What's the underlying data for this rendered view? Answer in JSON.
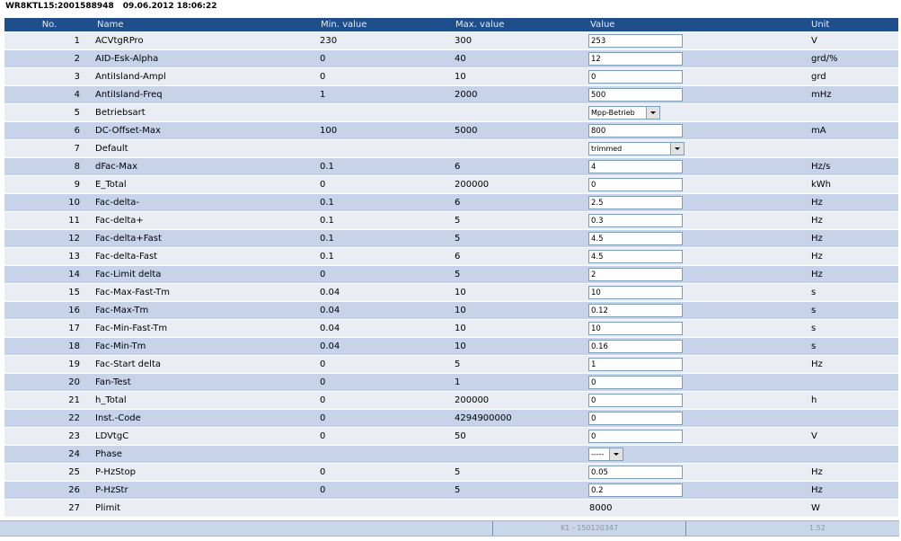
{
  "header": {
    "device": "WR8KTL15:2001588948",
    "timestamp": "09.06.2012 18:06:22"
  },
  "table": {
    "columns": {
      "no": "No.",
      "name": "Name",
      "min": "Min. value",
      "max": "Max. value",
      "value": "Value",
      "unit": "Unit"
    },
    "rows": [
      {
        "no": 1,
        "name": "ACVtgRPro",
        "min": "230",
        "max": "300",
        "value": "253",
        "unit": "V"
      },
      {
        "no": 2,
        "name": "AID-Esk-Alpha",
        "min": "0",
        "max": "40",
        "value": "12",
        "unit": "grd/%"
      },
      {
        "no": 3,
        "name": "AntiIsland-Ampl",
        "min": "0",
        "max": "10",
        "value": "0",
        "unit": "grd"
      },
      {
        "no": 4,
        "name": "AntiIsland-Freq",
        "min": "1",
        "max": "2000",
        "value": "500",
        "unit": "mHz"
      },
      {
        "no": 5,
        "name": "Betriebsart",
        "value": "Mpp-Betrieb"
      },
      {
        "no": 6,
        "name": "DC-Offset-Max",
        "min": "100",
        "max": "5000",
        "value": "800",
        "unit": "mA"
      },
      {
        "no": 7,
        "name": "Default",
        "value": "trimmed"
      },
      {
        "no": 8,
        "name": "dFac-Max",
        "min": "0.1",
        "max": "6",
        "value": "4",
        "unit": "Hz/s"
      },
      {
        "no": 9,
        "name": "E_Total",
        "min": "0",
        "max": "200000",
        "value": "0",
        "unit": "kWh"
      },
      {
        "no": 10,
        "name": "Fac-delta-",
        "min": "0.1",
        "max": "6",
        "value": "2.5",
        "unit": "Hz"
      },
      {
        "no": 11,
        "name": "Fac-delta+",
        "min": "0.1",
        "max": "5",
        "value": "0.3",
        "unit": "Hz"
      },
      {
        "no": 12,
        "name": "Fac-delta+Fast",
        "min": "0.1",
        "max": "5",
        "value": "4.5",
        "unit": "Hz"
      },
      {
        "no": 13,
        "name": "Fac-delta-Fast",
        "min": "0.1",
        "max": "6",
        "value": "4.5",
        "unit": "Hz"
      },
      {
        "no": 14,
        "name": "Fac-Limit delta",
        "min": "0",
        "max": "5",
        "value": "2",
        "unit": "Hz"
      },
      {
        "no": 15,
        "name": "Fac-Max-Fast-Tm",
        "min": "0.04",
        "max": "10",
        "value": "10",
        "unit": "s"
      },
      {
        "no": 16,
        "name": "Fac-Max-Tm",
        "min": "0.04",
        "max": "10",
        "value": "0.12",
        "unit": "s"
      },
      {
        "no": 17,
        "name": "Fac-Min-Fast-Tm",
        "min": "0.04",
        "max": "10",
        "value": "10",
        "unit": "s"
      },
      {
        "no": 18,
        "name": "Fac-Min-Tm",
        "min": "0.04",
        "max": "10",
        "value": "0.16",
        "unit": "s"
      },
      {
        "no": 19,
        "name": "Fac-Start delta",
        "min": "0",
        "max": "5",
        "value": "1",
        "unit": "Hz"
      },
      {
        "no": 20,
        "name": "Fan-Test",
        "min": "0",
        "max": "1",
        "value": "0"
      },
      {
        "no": 21,
        "name": "h_Total",
        "min": "0",
        "max": "200000",
        "value": "0",
        "unit": "h"
      },
      {
        "no": 22,
        "name": "Inst.-Code",
        "min": "0",
        "max": "4294900000",
        "value": "0"
      },
      {
        "no": 23,
        "name": "LDVtgC",
        "min": "0",
        "max": "50",
        "value": "0",
        "unit": "V"
      },
      {
        "no": 24,
        "name": "Phase",
        "value": "-----"
      },
      {
        "no": 25,
        "name": "P-HzStop",
        "min": "0",
        "max": "5",
        "value": "0.05",
        "unit": "Hz"
      },
      {
        "no": 26,
        "name": "P-HzStr",
        "min": "0",
        "max": "5",
        "value": "0.2",
        "unit": "Hz"
      },
      {
        "no": 27,
        "name": "Plimit",
        "value": "8000",
        "unit": "W"
      }
    ]
  },
  "footer": {
    "center": "K1 - 150120347",
    "right": "1.52"
  },
  "colors": {
    "header_bg": "#1f4e8c",
    "header_text": "#e6ecf6",
    "row_light": "#eaedf4",
    "row_blue": "#c6d3e9",
    "footer_bg": "#cad6e9",
    "footer_text": "#8a95a8"
  }
}
